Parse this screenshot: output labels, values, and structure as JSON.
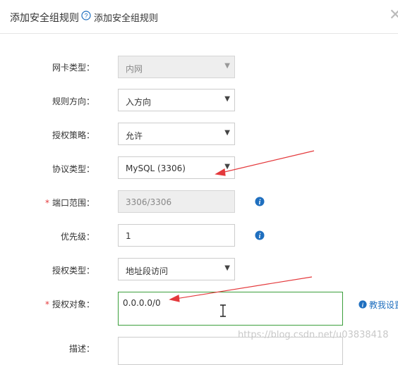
{
  "header": {
    "title": "添加安全组规则",
    "subtitle": "添加安全组规则",
    "help_icon": "question-circle-icon",
    "close_icon": "close-icon"
  },
  "form": {
    "nic_type": {
      "label": "网卡类型：",
      "value": "内网",
      "disabled": true
    },
    "direction": {
      "label": "规则方向：",
      "value": "入方向"
    },
    "policy": {
      "label": "授权策略：",
      "value": "允许"
    },
    "protocol": {
      "label": "协议类型：",
      "value": "MySQL (3306)"
    },
    "port_range": {
      "label": "端口范围：",
      "value": "3306/3306",
      "required": "*",
      "disabled": true
    },
    "priority": {
      "label": "优先级：",
      "value": "1"
    },
    "auth_type": {
      "label": "授权类型：",
      "value": "地址段访问"
    },
    "auth_object": {
      "label": "授权对象：",
      "value": "0.0.0.0/0",
      "required": "*",
      "link": "教我设置"
    },
    "description": {
      "label": "描述："
    }
  },
  "watermark": "https://blog.csdn.net/u03838418",
  "colors": {
    "annotation_arrow": "#e4393c",
    "info_icon": "#1f6fbf",
    "focus_border": "#3c9f3c"
  }
}
